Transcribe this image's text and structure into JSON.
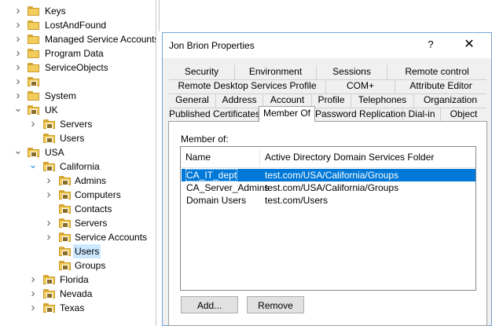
{
  "tree": {
    "items": [
      {
        "label": "Keys",
        "expander": "collapsed"
      },
      {
        "label": "LostAndFound",
        "expander": "collapsed"
      },
      {
        "label": "Managed Service Accounts",
        "expander": "collapsed"
      },
      {
        "label": "Program Data",
        "expander": "collapsed"
      },
      {
        "label": "ServiceObjects",
        "expander": "collapsed"
      },
      {
        "label": "",
        "expander": "collapsed"
      },
      {
        "label": "System",
        "expander": "collapsed"
      },
      {
        "label": "UK",
        "expander": "expanded"
      },
      {
        "label": "Servers",
        "expander": "collapsed"
      },
      {
        "label": "Users",
        "expander": "none"
      },
      {
        "label": "USA",
        "expander": "expanded"
      },
      {
        "label": "California",
        "expander": "expanded-blue"
      },
      {
        "label": "Admins",
        "expander": "collapsed"
      },
      {
        "label": "Computers",
        "expander": "collapsed"
      },
      {
        "label": "Contacts",
        "expander": "none"
      },
      {
        "label": "Servers",
        "expander": "collapsed"
      },
      {
        "label": "Service Accounts",
        "expander": "collapsed"
      },
      {
        "label": "Users",
        "expander": "none",
        "selected": true
      },
      {
        "label": "Groups",
        "expander": "none"
      },
      {
        "label": "Florida",
        "expander": "collapsed"
      },
      {
        "label": "Nevada",
        "expander": "collapsed"
      },
      {
        "label": "Texas",
        "expander": "collapsed"
      }
    ]
  },
  "dialog": {
    "title": "Jon Brion Properties",
    "help_label": "?",
    "close_label": "✕",
    "tabs_row1": [
      "Security",
      "Environment",
      "Sessions",
      "Remote control"
    ],
    "tabs_row2": [
      "Remote Desktop Services Profile",
      "COM+",
      "Attribute Editor"
    ],
    "tabs_row3": [
      "General",
      "Address",
      "Account",
      "Profile",
      "Telephones",
      "Organization"
    ],
    "tabs_row4": [
      "Published Certificates",
      "Member Of",
      "Password Replication",
      "Dial-in",
      "Object"
    ],
    "active_tab": "Member Of",
    "member_of_label": "Member of:",
    "columns": [
      "Name",
      "Active Directory Domain Services Folder"
    ],
    "rows": [
      {
        "name": "CA_IT_dept",
        "folder": "test.com/USA/California/Groups",
        "selected": true
      },
      {
        "name": "CA_Server_Admins",
        "folder": "test.com/USA/California/Groups"
      },
      {
        "name": "Domain Users",
        "folder": "test.com/Users"
      }
    ],
    "add_label": "Add...",
    "remove_label": "Remove"
  },
  "colors": {
    "selection": "#0078d7",
    "tree_selection": "#cce8ff",
    "folder": "#f2cd5c"
  }
}
